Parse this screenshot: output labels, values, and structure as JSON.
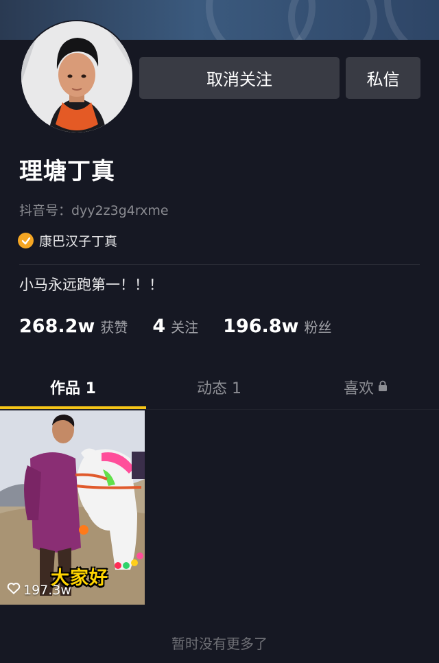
{
  "profile": {
    "name": "理塘丁真",
    "douyin_id": "抖音号：dyy2z3g4rxme",
    "verification": "康巴汉子丁真",
    "bio": "小马永远跑第一！！！"
  },
  "actions": {
    "unfollow_label": "取消关注",
    "message_label": "私信"
  },
  "stats": [
    {
      "value": "268.2w",
      "label": "获赞"
    },
    {
      "value": "4",
      "label": "关注"
    },
    {
      "value": "196.8w",
      "label": "粉丝"
    }
  ],
  "tabs": [
    {
      "label": "作品 1",
      "active": true
    },
    {
      "label": "动态 1",
      "active": false
    },
    {
      "label": "喜欢",
      "active": false,
      "icon": "lock-icon"
    }
  ],
  "videos": [
    {
      "likes": "197.3w",
      "caption": "大家好"
    }
  ],
  "footer_text": "暂时没有更多了",
  "colors": {
    "background": "#161823",
    "button": "#393b44",
    "tab_indicator": "#f5c518",
    "verify_badge": "#f5a623",
    "caption": "#ffd400"
  }
}
